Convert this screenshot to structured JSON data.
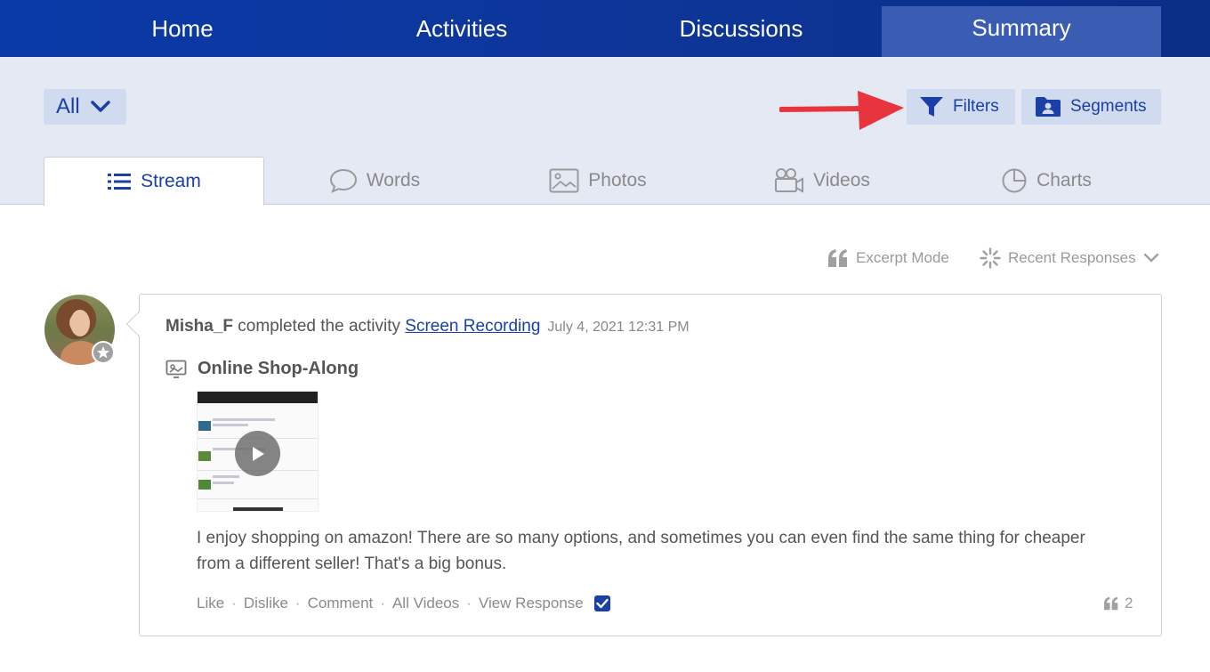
{
  "nav": {
    "tabs": [
      {
        "label": "Home"
      },
      {
        "label": "Activities"
      },
      {
        "label": "Discussions"
      },
      {
        "label": "Summary",
        "active": true
      }
    ]
  },
  "toolbar": {
    "scope_dropdown": "All",
    "filters_label": "Filters",
    "segments_label": "Segments"
  },
  "view_tabs": [
    {
      "label": "Stream",
      "icon": "list-icon",
      "active": true
    },
    {
      "label": "Words",
      "icon": "speech-bubble-icon"
    },
    {
      "label": "Photos",
      "icon": "photo-icon"
    },
    {
      "label": "Videos",
      "icon": "video-camera-icon"
    },
    {
      "label": "Charts",
      "icon": "pie-chart-icon"
    }
  ],
  "stream_options": {
    "excerpt_mode": "Excerpt Mode",
    "sort": "Recent Responses"
  },
  "post": {
    "user": "Misha_F",
    "verb": " completed the activity ",
    "activity": "Screen Recording",
    "date": "July 4, 2021 12:31 PM",
    "title": "Online Shop-Along",
    "response": "I enjoy shopping on amazon! There are so many options, and sometimes you can even find the same thing for cheaper from a different seller! That's a big bonus.",
    "actions": [
      "Like",
      "Dislike",
      "Comment",
      "All Videos",
      "View Response"
    ],
    "quote_count": "2"
  },
  "colors": {
    "nav_bg": "#0d3596",
    "accent": "#1a3fa6",
    "subbar_bg": "#e4e9f4",
    "annotation_arrow": "#e8343c"
  }
}
